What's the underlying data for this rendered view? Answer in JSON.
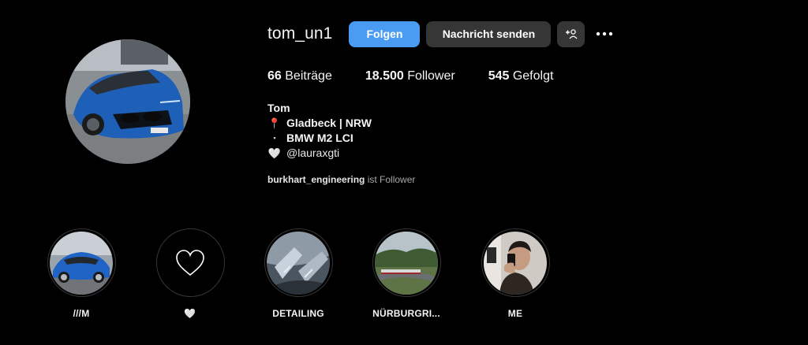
{
  "profile": {
    "username": "tom_un1",
    "follow_label": "Folgen",
    "message_label": "Nachricht senden",
    "add_user_icon": "add-user-icon",
    "more_icon": "more-options-icon"
  },
  "stats": {
    "posts_count": "66",
    "posts_label": " Beiträge",
    "followers_count": "18.500",
    "followers_label": " Follower",
    "following_count": "545",
    "following_label": " Gefolgt"
  },
  "bio": {
    "name": "Tom",
    "lines": [
      {
        "emoji": "📍",
        "text": "Gladbeck | NRW"
      },
      {
        "emoji": "▪",
        "text": "BMW M2 LCI"
      },
      {
        "emoji": "🤍",
        "text": "@lauraxgti"
      }
    ]
  },
  "followed_by": {
    "account": "burkhart_engineering",
    "suffix": " ist Follower"
  },
  "highlights": [
    {
      "label": "///M"
    },
    {
      "label": "🤍"
    },
    {
      "label": "DETAILING"
    },
    {
      "label": "NÜRBURGRI..."
    },
    {
      "label": "ME"
    }
  ],
  "colors": {
    "background": "#000000",
    "primary_button": "#4a9cf2",
    "secondary_button": "#363636",
    "muted_text": "#a8a8a8"
  }
}
